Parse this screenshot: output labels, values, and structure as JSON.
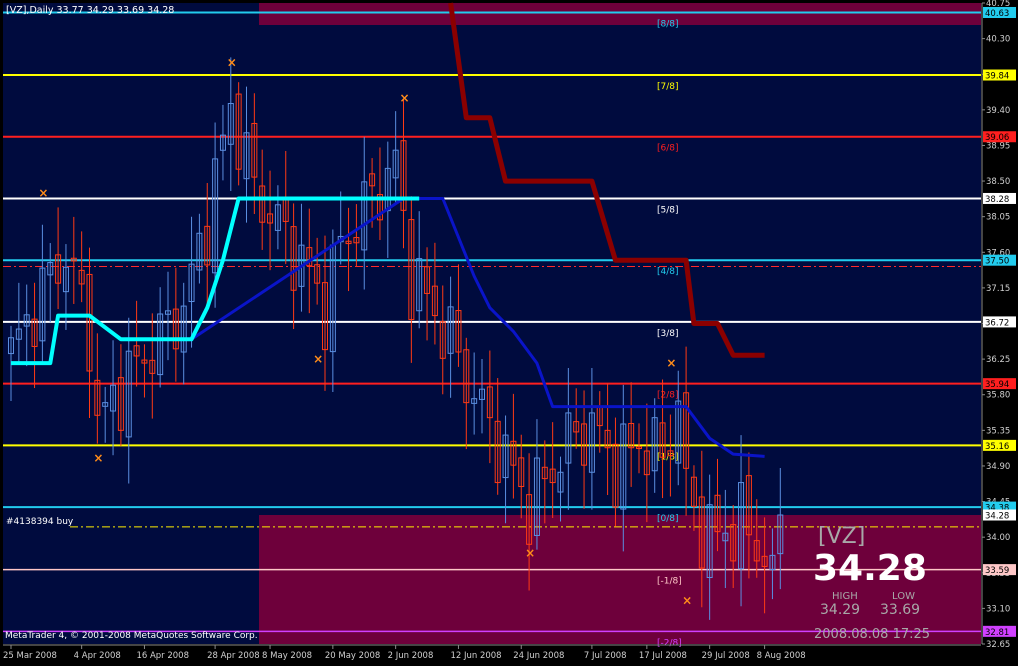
{
  "header": {
    "symbol_line": "[VZ],Daily  33.77 34.29 33.69 34.28",
    "order_label": "#4138394 buy",
    "copyright": "MetaTrader 4, © 2001-2008 MetaQuotes Software Corp."
  },
  "info_panel": {
    "symbol": "[VZ]",
    "last_price": "34.28",
    "high_label": "HIGH",
    "low_label": "LOW",
    "high_value": "34.29",
    "low_value": "33.69",
    "datetime": "2008.08.08 17:25"
  },
  "colors": {
    "background": "#000000",
    "plot_bg": "#000b3e",
    "zone_bg": "#6e003b",
    "grid_text": "#d0d0d0",
    "level_cyan": "#22ccee",
    "level_yellow": "#ffff00",
    "level_red": "#ff1f1f",
    "level_white": "#ffffff",
    "level_pink": "#ffc8c8",
    "level_magenta": "#d040ff",
    "bull_candle": "#5a8ee0",
    "bear_candle": "#ff3a14",
    "support_line": "#00ffff",
    "trend_line": "#0a14c8",
    "stop_line": "#8b0000",
    "fractal": "#ff8c1a"
  },
  "chart_data": {
    "type": "candlestick",
    "symbol": "[VZ]",
    "timeframe": "Daily",
    "ylim": [
      32.65,
      40.75
    ],
    "y_ticks": [
      "40.75",
      "40.30",
      "39.85",
      "39.40",
      "38.95",
      "38.50",
      "38.05",
      "37.60",
      "37.15",
      "36.70",
      "36.25",
      "35.80",
      "35.35",
      "34.90",
      "34.45",
      "34.00",
      "33.55",
      "33.10",
      "32.65"
    ],
    "x_tick_labels": [
      "25 Mar 2008",
      "4 Apr 2008",
      "16 Apr 2008",
      "28 Apr 2008",
      "8 May 2008",
      "20 May 2008",
      "2 Jun 2008",
      "12 Jun 2008",
      "24 Jun 2008",
      "7 Jul 2008",
      "17 Jul 2008",
      "29 Jul 2008",
      "8 Aug 2008"
    ],
    "x_tick_bars": [
      0,
      9,
      17,
      26,
      33,
      41,
      49,
      57,
      65,
      74,
      81,
      89,
      96
    ],
    "bar_count": 99,
    "murrey_levels": [
      {
        "label": "[8/8]",
        "price": 40.63,
        "color": "cyan"
      },
      {
        "label": "[7/8]",
        "price": 39.84,
        "color": "yellow"
      },
      {
        "label": "[6/8]",
        "price": 39.06,
        "color": "red"
      },
      {
        "label": "[5/8]",
        "price": 38.28,
        "color": "white"
      },
      {
        "label": "[4/8]",
        "price": 37.5,
        "color": "cyan"
      },
      {
        "label": "[3/8]",
        "price": 36.72,
        "color": "white"
      },
      {
        "label": "[2/8]",
        "price": 35.94,
        "color": "red"
      },
      {
        "label": "[1/8]",
        "price": 35.16,
        "color": "yellow"
      },
      {
        "label": "[0/8]",
        "price": 34.38,
        "color": "cyan"
      },
      {
        "label": "[-1/8]",
        "price": 33.59,
        "color": "pink"
      },
      {
        "label": "[-2/8]",
        "price": 32.81,
        "color": "magenta"
      }
    ],
    "price_tags": [
      {
        "text": "40.63",
        "price": 40.63
      },
      {
        "text": "39.84",
        "price": 39.84
      },
      {
        "text": "39.06",
        "price": 39.06
      },
      {
        "text": "38.28",
        "price": 38.28
      },
      {
        "text": "37.50",
        "price": 37.5
      },
      {
        "text": "36.72",
        "price": 36.72
      },
      {
        "text": "35.94",
        "price": 35.94
      },
      {
        "text": "35.16",
        "price": 35.16
      },
      {
        "text": "34.38",
        "price": 34.38
      },
      {
        "text": "34.28",
        "price": 34.28
      },
      {
        "text": "33.59",
        "price": 33.59
      },
      {
        "text": "32.81",
        "price": 32.81
      }
    ],
    "dash_levels": [
      37.42,
      34.13
    ],
    "support_line": [
      [
        0,
        36.2
      ],
      [
        5,
        36.2
      ],
      [
        6,
        36.8
      ],
      [
        10,
        36.8
      ],
      [
        14,
        36.5
      ],
      [
        23,
        36.5
      ],
      [
        25,
        36.9
      ],
      [
        27,
        37.5
      ],
      [
        29,
        38.28
      ],
      [
        52,
        38.28
      ]
    ],
    "trend_line": [
      [
        10,
        36.8
      ],
      [
        14,
        36.5
      ],
      [
        23,
        36.5
      ],
      [
        50,
        38.28
      ],
      [
        55,
        38.28
      ],
      [
        59,
        37.3
      ],
      [
        61,
        36.9
      ],
      [
        64,
        36.6
      ],
      [
        67,
        36.2
      ],
      [
        69,
        35.65
      ],
      [
        86,
        35.65
      ],
      [
        89,
        35.25
      ],
      [
        92,
        35.05
      ],
      [
        96,
        35.02
      ]
    ],
    "stop_line": [
      [
        56,
        40.75
      ],
      [
        58,
        39.3
      ],
      [
        61,
        39.3
      ],
      [
        63,
        38.5
      ],
      [
        74,
        38.5
      ],
      [
        77,
        37.5
      ],
      [
        86,
        37.5
      ],
      [
        87,
        36.7
      ],
      [
        90,
        36.7
      ],
      [
        92,
        36.3
      ],
      [
        96,
        36.3
      ]
    ],
    "fractal_markers": [
      [
        4,
        38.35
      ],
      [
        11,
        35.0
      ],
      [
        28,
        40.0
      ],
      [
        39,
        36.25
      ],
      [
        50,
        39.55
      ],
      [
        66,
        33.8
      ],
      [
        84,
        36.2
      ],
      [
        86,
        33.2
      ]
    ],
    "seed_closes": [
      [
        0,
        36.3
      ],
      [
        4,
        37.1
      ],
      [
        7,
        37.6
      ],
      [
        10,
        36.6
      ],
      [
        11,
        35.4
      ],
      [
        14,
        35.9
      ],
      [
        18,
        36.4
      ],
      [
        22,
        36.9
      ],
      [
        25,
        38.0
      ],
      [
        28,
        39.45
      ],
      [
        31,
        38.4
      ],
      [
        35,
        37.8
      ],
      [
        38,
        37.3
      ],
      [
        40,
        36.9
      ],
      [
        42,
        37.7
      ],
      [
        46,
        38.3
      ],
      [
        49,
        38.7
      ],
      [
        51,
        37.3
      ],
      [
        53,
        37.0
      ],
      [
        56,
        36.5
      ],
      [
        58,
        36.0
      ],
      [
        61,
        35.4
      ],
      [
        64,
        34.8
      ],
      [
        66,
        34.4
      ],
      [
        68,
        34.7
      ],
      [
        71,
        35.2
      ],
      [
        74,
        35.4
      ],
      [
        77,
        34.9
      ],
      [
        80,
        35.2
      ],
      [
        83,
        35.0
      ],
      [
        85,
        35.7
      ],
      [
        86,
        34.6
      ],
      [
        88,
        34.1
      ],
      [
        90,
        34.0
      ],
      [
        93,
        34.2
      ],
      [
        96,
        33.77
      ],
      [
        97,
        34.28
      ]
    ]
  }
}
